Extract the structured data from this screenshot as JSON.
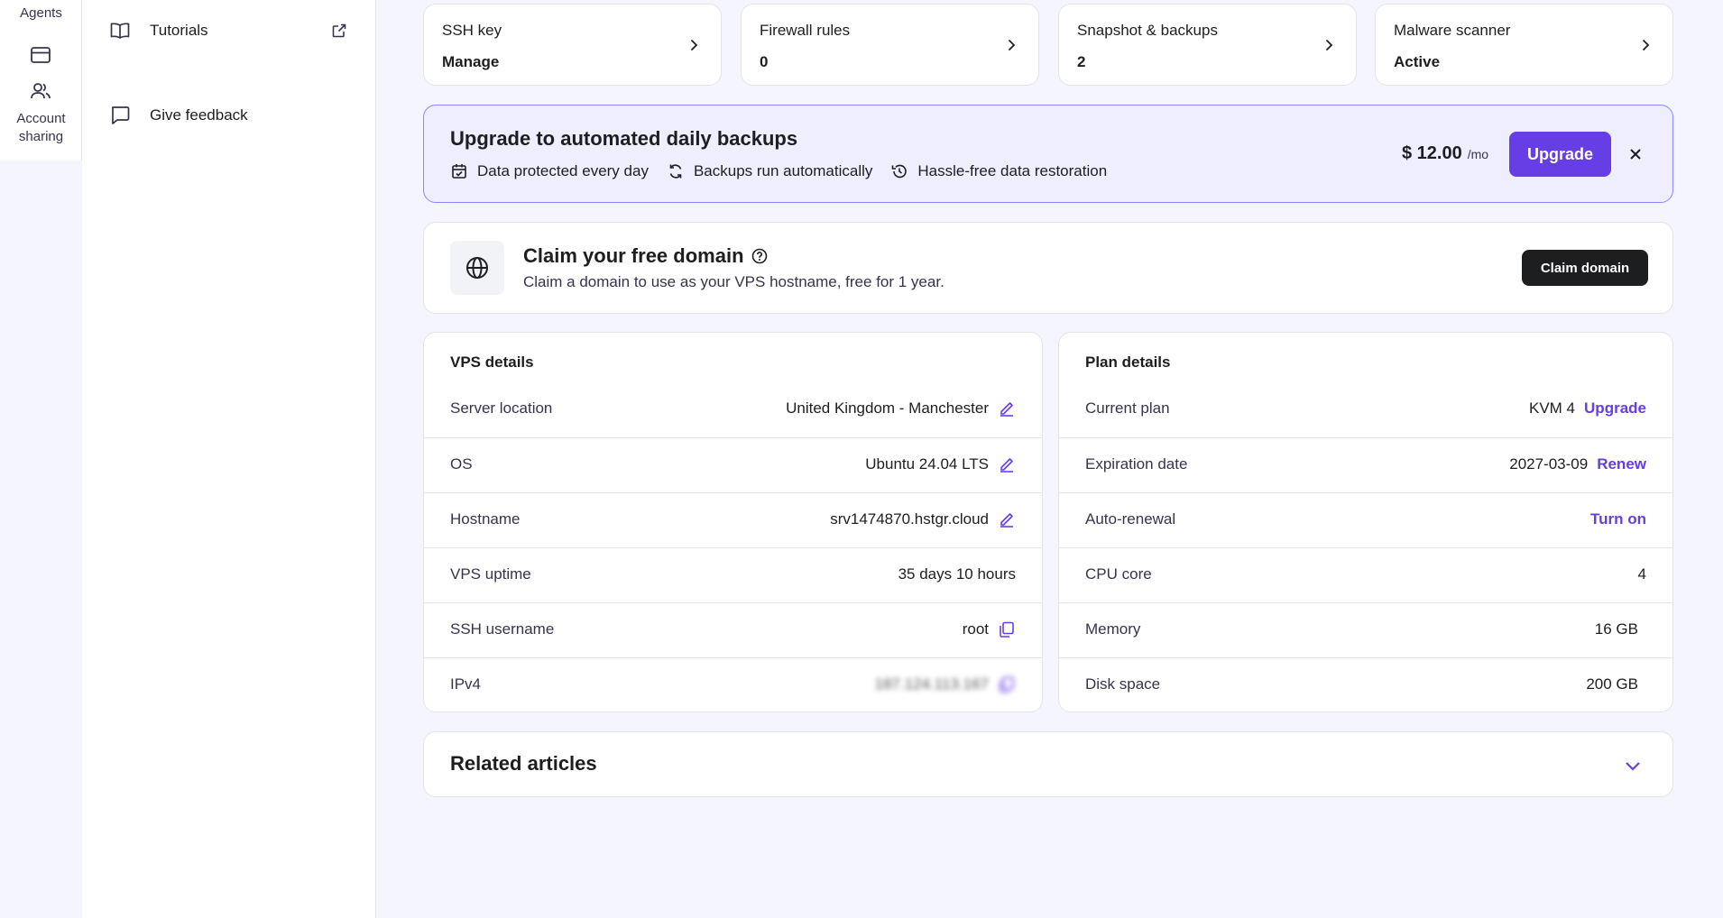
{
  "rail": {
    "agents_label": "Agents",
    "account_sharing_label": "Account sharing"
  },
  "sidebar": {
    "items": [
      {
        "label": "Tutorials",
        "icon": "book-icon",
        "external": true
      },
      {
        "label": "Give feedback",
        "icon": "chat-bubble-icon",
        "external": false
      }
    ]
  },
  "stats": [
    {
      "label": "SSH key",
      "value": "Manage"
    },
    {
      "label": "Firewall rules",
      "value": "0"
    },
    {
      "label": "Snapshot & backups",
      "value": "2"
    },
    {
      "label": "Malware scanner",
      "value": "Active"
    }
  ],
  "promo": {
    "title": "Upgrade to automated daily backups",
    "features": [
      "Data protected every day",
      "Backups run automatically",
      "Hassle-free data restoration"
    ],
    "price": "$ 12.00",
    "period": "/mo",
    "button": "Upgrade"
  },
  "domain": {
    "title": "Claim your free domain",
    "subtitle": "Claim a domain to use as your VPS hostname, free for 1 year.",
    "button": "Claim domain"
  },
  "vps_details": {
    "title": "VPS details",
    "rows": [
      {
        "label": "Server location",
        "value": "United Kingdom - Manchester"
      },
      {
        "label": "OS",
        "value": "Ubuntu 24.04 LTS"
      },
      {
        "label": "Hostname",
        "value": "srv1474870.hstgr.cloud"
      },
      {
        "label": "VPS uptime",
        "value": "35 days 10 hours"
      },
      {
        "label": "SSH username",
        "value": "root"
      },
      {
        "label": "IPv4",
        "value": "187.124.113.167"
      }
    ]
  },
  "plan_details": {
    "title": "Plan details",
    "rows": [
      {
        "label": "Current plan",
        "value": "KVM 4",
        "action": "Upgrade"
      },
      {
        "label": "Expiration date",
        "value": "2027-03-09",
        "action": "Renew"
      },
      {
        "label": "Auto-renewal",
        "action": "Turn on"
      },
      {
        "label": "CPU core",
        "value": "4"
      },
      {
        "label": "Memory",
        "value": "16 GB"
      },
      {
        "label": "Disk space",
        "value": "200 GB"
      }
    ]
  },
  "related": {
    "title": "Related articles"
  },
  "colors": {
    "accent": "#673de6",
    "promo_bg": "#efeefe",
    "promo_border": "#8c85ff",
    "dark_button": "#1d1e20"
  }
}
